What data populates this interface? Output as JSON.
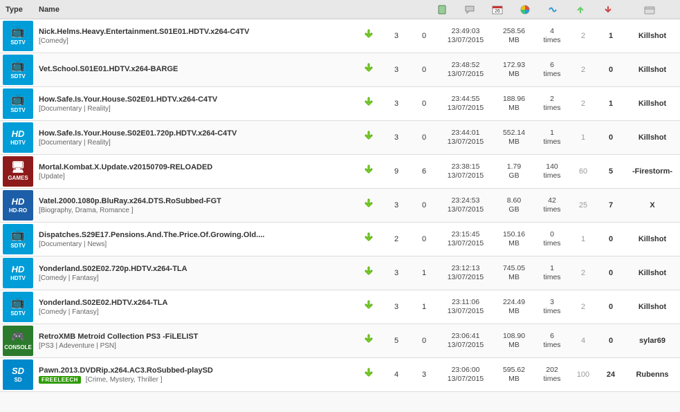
{
  "header": {
    "type": "Type",
    "name": "Name"
  },
  "colors": {
    "sdtv": "#009dd8",
    "hdtv": "#009dd8",
    "games": "#8e1b1b",
    "hdro": "#1c5ea8",
    "console": "#2c7a2c",
    "sd": "#0088cc"
  },
  "rows": [
    {
      "cat": "sdtv",
      "catLabel": "SDTV",
      "catGlyph": "📺",
      "title": "Nick.Helms.Heavy.Entertainment.S01E01.HDTV.x264-C4TV",
      "tags": "[Comedy]",
      "freeleech": false,
      "snatch": "3",
      "files": "0",
      "time": "23:49:03",
      "date": "13/07/2015",
      "size": "258.56",
      "sizeUnit": "MB",
      "times": "4",
      "seeds": "2",
      "leech": "1",
      "uploader": "Killshot"
    },
    {
      "cat": "sdtv",
      "catLabel": "SDTV",
      "catGlyph": "📺",
      "title": "Vet.School.S01E01.HDTV.x264-BARGE",
      "tags": "",
      "freeleech": false,
      "snatch": "3",
      "files": "0",
      "time": "23:48:52",
      "date": "13/07/2015",
      "size": "172.93",
      "sizeUnit": "MB",
      "times": "6",
      "seeds": "2",
      "leech": "0",
      "uploader": "Killshot"
    },
    {
      "cat": "sdtv",
      "catLabel": "SDTV",
      "catGlyph": "📺",
      "title": "How.Safe.Is.Your.House.S02E01.HDTV.x264-C4TV",
      "tags": "[Documentary | Reality]",
      "freeleech": false,
      "snatch": "3",
      "files": "0",
      "time": "23:44:55",
      "date": "13/07/2015",
      "size": "188.96",
      "sizeUnit": "MB",
      "times": "2",
      "seeds": "2",
      "leech": "1",
      "uploader": "Killshot"
    },
    {
      "cat": "hdtv",
      "catLabel": "HDTV",
      "catGlyph": "HD",
      "title": "How.Safe.Is.Your.House.S02E01.720p.HDTV.x264-C4TV",
      "tags": "[Documentary | Reality]",
      "freeleech": false,
      "snatch": "3",
      "files": "0",
      "time": "23:44:01",
      "date": "13/07/2015",
      "size": "552.14",
      "sizeUnit": "MB",
      "times": "1",
      "seeds": "1",
      "leech": "0",
      "uploader": "Killshot"
    },
    {
      "cat": "games",
      "catLabel": "GAMES",
      "catGlyph": "🖥",
      "title": "Mortal.Kombat.X.Update.v20150709-RELOADED",
      "tags": "[Update]",
      "freeleech": false,
      "snatch": "9",
      "files": "6",
      "time": "23:38:15",
      "date": "13/07/2015",
      "size": "1.79",
      "sizeUnit": "GB",
      "times": "140",
      "seeds": "60",
      "leech": "5",
      "uploader": "-Firestorm-"
    },
    {
      "cat": "hdro",
      "catLabel": "HD-RO",
      "catGlyph": "HD",
      "title": "Vatel.2000.1080p.BluRay.x264.DTS.RoSubbed-FGT",
      "tags": "[Biography, Drama, Romance ]",
      "freeleech": false,
      "snatch": "3",
      "files": "0",
      "time": "23:24:53",
      "date": "13/07/2015",
      "size": "8.60",
      "sizeUnit": "GB",
      "times": "42",
      "seeds": "25",
      "leech": "7",
      "uploader": "X"
    },
    {
      "cat": "sdtv",
      "catLabel": "SDTV",
      "catGlyph": "📺",
      "title": "Dispatches.S29E17.Pensions.And.The.Price.Of.Growing.Old....",
      "tags": "[Documentary | News]",
      "freeleech": false,
      "snatch": "2",
      "files": "0",
      "time": "23:15:45",
      "date": "13/07/2015",
      "size": "150.16",
      "sizeUnit": "MB",
      "times": "0",
      "seeds": "1",
      "leech": "0",
      "uploader": "Killshot"
    },
    {
      "cat": "hdtv",
      "catLabel": "HDTV",
      "catGlyph": "HD",
      "title": "Yonderland.S02E02.720p.HDTV.x264-TLA",
      "tags": "[Comedy | Fantasy]",
      "freeleech": false,
      "snatch": "3",
      "files": "1",
      "time": "23:12:13",
      "date": "13/07/2015",
      "size": "745.05",
      "sizeUnit": "MB",
      "times": "1",
      "seeds": "2",
      "leech": "0",
      "uploader": "Killshot"
    },
    {
      "cat": "sdtv",
      "catLabel": "SDTV",
      "catGlyph": "📺",
      "title": "Yonderland.S02E02.HDTV.x264-TLA",
      "tags": "[Comedy | Fantasy]",
      "freeleech": false,
      "snatch": "3",
      "files": "1",
      "time": "23:11:06",
      "date": "13/07/2015",
      "size": "224.49",
      "sizeUnit": "MB",
      "times": "3",
      "seeds": "2",
      "leech": "0",
      "uploader": "Killshot"
    },
    {
      "cat": "console",
      "catLabel": "CONSOLE",
      "catGlyph": "🎮",
      "title": "RetroXMB Metroid Collection PS3 -FiLELIST",
      "tags": "[PS3 | Adeventure | PSN]",
      "freeleech": false,
      "snatch": "5",
      "files": "0",
      "time": "23:06:41",
      "date": "13/07/2015",
      "size": "108.90",
      "sizeUnit": "MB",
      "times": "6",
      "seeds": "4",
      "leech": "0",
      "uploader": "sylar69"
    },
    {
      "cat": "sd",
      "catLabel": "SD",
      "catGlyph": "SD",
      "title": "Pawn.2013.DVDRip.x264.AC3.RoSubbed-playSD",
      "tags": "[Crime, Mystery, Thriller ]",
      "freeleech": true,
      "freeleechLabel": "FREELEECH",
      "snatch": "4",
      "files": "3",
      "time": "23:06:00",
      "date": "13/07/2015",
      "size": "595.62",
      "sizeUnit": "MB",
      "times": "202",
      "seeds": "100",
      "leech": "24",
      "uploader": "Rubenns"
    }
  ]
}
